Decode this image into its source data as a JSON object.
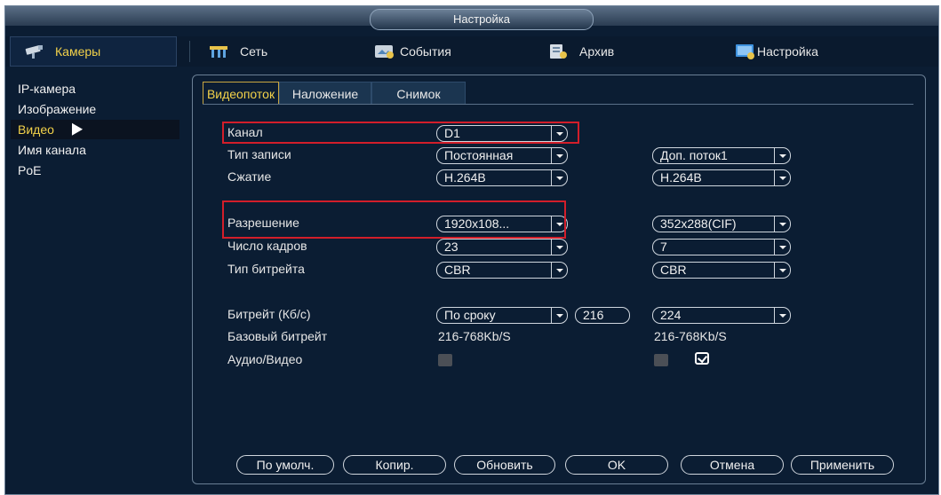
{
  "window_title": "Настройка",
  "nav": {
    "cameras": "Камеры",
    "network": "Сеть",
    "events": "События",
    "archive": "Архив",
    "settings": "Настройка"
  },
  "sidebar": {
    "items": [
      "IP-камера",
      "Изображение",
      "Видео",
      "Имя канала",
      "PoE"
    ],
    "active": "Видео"
  },
  "tabs": [
    "Видеопоток",
    "Наложение",
    "Снимок"
  ],
  "form": {
    "channel_label": "Канал",
    "channel_value": "D1",
    "record_type_label": "Тип записи",
    "record_type_value": "Постоянная",
    "sub_stream_value": "Доп. поток1",
    "compression_label": "Сжатие",
    "compression_main": "H.264B",
    "compression_sub": "H.264B",
    "resolution_label": "Разрешение",
    "resolution_main": "1920x108...",
    "resolution_sub": "352x288(CIF)",
    "framerate_label": "Число кадров",
    "framerate_main": "23",
    "framerate_sub": "7",
    "bitrate_type_label": "Тип битрейта",
    "bitrate_type_main": "CBR",
    "bitrate_type_sub": "CBR",
    "bitrate_label": "Битрейт (Кб/с)",
    "bitrate_mode": "По сроку",
    "bitrate_main": "216",
    "bitrate_sub": "224",
    "base_bitrate_label": "Базовый битрейт",
    "base_bitrate_main": "216-768Kb/S",
    "base_bitrate_sub": "216-768Kb/S",
    "audio_video_label": "Аудио/Видео",
    "audio_video_main_checked": false,
    "audio_video_sub1_checked": false,
    "audio_video_sub2_checked": true
  },
  "buttons": {
    "default": "По умолч.",
    "copy": "Копир.",
    "refresh": "Обновить",
    "ok": "OK",
    "cancel": "Отмена",
    "apply": "Применить"
  },
  "colors": {
    "background": "#0b1d33",
    "accent_active": "#f3d24a",
    "highlight": "#d21e2a"
  }
}
